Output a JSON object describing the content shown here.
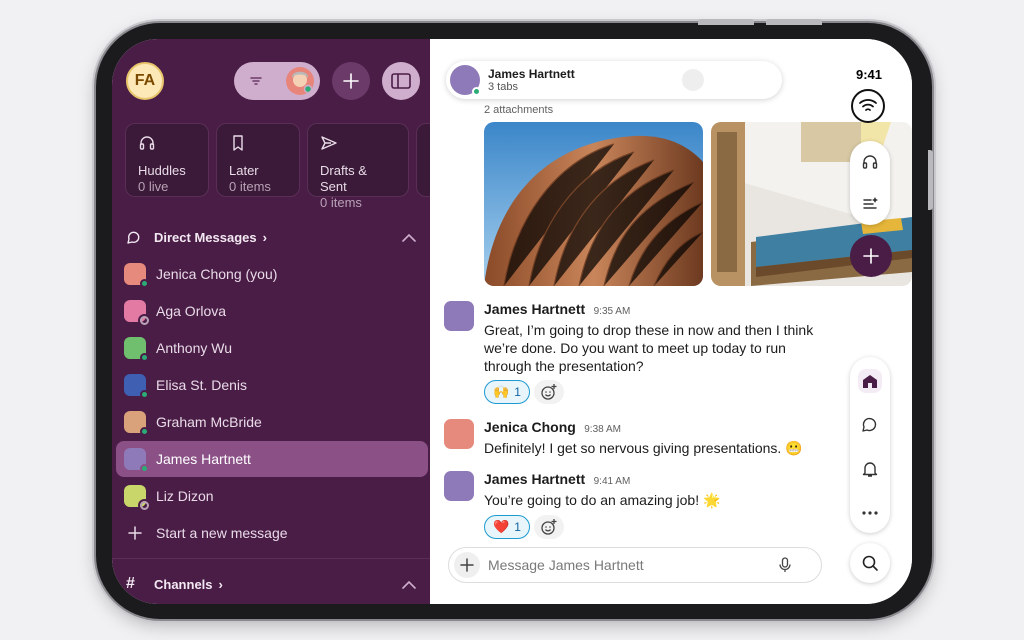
{
  "sidebar": {
    "workspace_initials": "FA",
    "tiles": [
      {
        "label": "Huddles",
        "sub": "0 live",
        "icon": "headphones-icon"
      },
      {
        "label": "Later",
        "sub": "0 items",
        "icon": "bookmark-icon"
      },
      {
        "label": "Drafts & Sent",
        "sub": "0 items",
        "icon": "send-icon"
      }
    ],
    "dm_header": "Direct Messages",
    "dms": [
      {
        "name": "Jenica Chong (you)",
        "online": true,
        "color": "#e58a7c"
      },
      {
        "name": "Aga Orlova",
        "online": false,
        "color": "#e27aa4"
      },
      {
        "name": "Anthony Wu",
        "online": true,
        "color": "#6fbf6f"
      },
      {
        "name": "Elisa St. Denis",
        "online": true,
        "color": "#3f5fb3"
      },
      {
        "name": "Graham McBride",
        "online": true,
        "color": "#d9a27a"
      },
      {
        "name": "James Hartnett",
        "online": true,
        "color": "#8e7ab8"
      },
      {
        "name": "Liz Dizon",
        "online": false,
        "color": "#c9d66a"
      }
    ],
    "new_message": "Start a new message",
    "channels_header": "Channels"
  },
  "chat": {
    "tab_title": "James Hartnett",
    "tab_sub": "3 tabs",
    "status_time": "9:41",
    "attachments_label": "2 attachments",
    "messages": [
      {
        "author": "James Hartnett",
        "time": "9:35 AM",
        "text": "Great, I’m going to drop these in now and then I think we’re done. Do you want to meet up today to run through the presentation?",
        "reaction": {
          "emoji": "🙌",
          "count": "1"
        }
      },
      {
        "author": "Jenica Chong",
        "time": "9:38 AM",
        "text": "Definitely! I get so nervous giving presentations. 😬"
      },
      {
        "author": "James Hartnett",
        "time": "9:41 AM",
        "text": "You’re going to do an amazing job! 🌟",
        "reaction": {
          "emoji": "❤️",
          "count": "1"
        }
      }
    ],
    "composer_placeholder": "Message James Hartnett"
  },
  "colors": {
    "sidebar_bg": "#4a1d47",
    "active_row": "#8b5187",
    "reaction_border": "#1d9bd1"
  }
}
